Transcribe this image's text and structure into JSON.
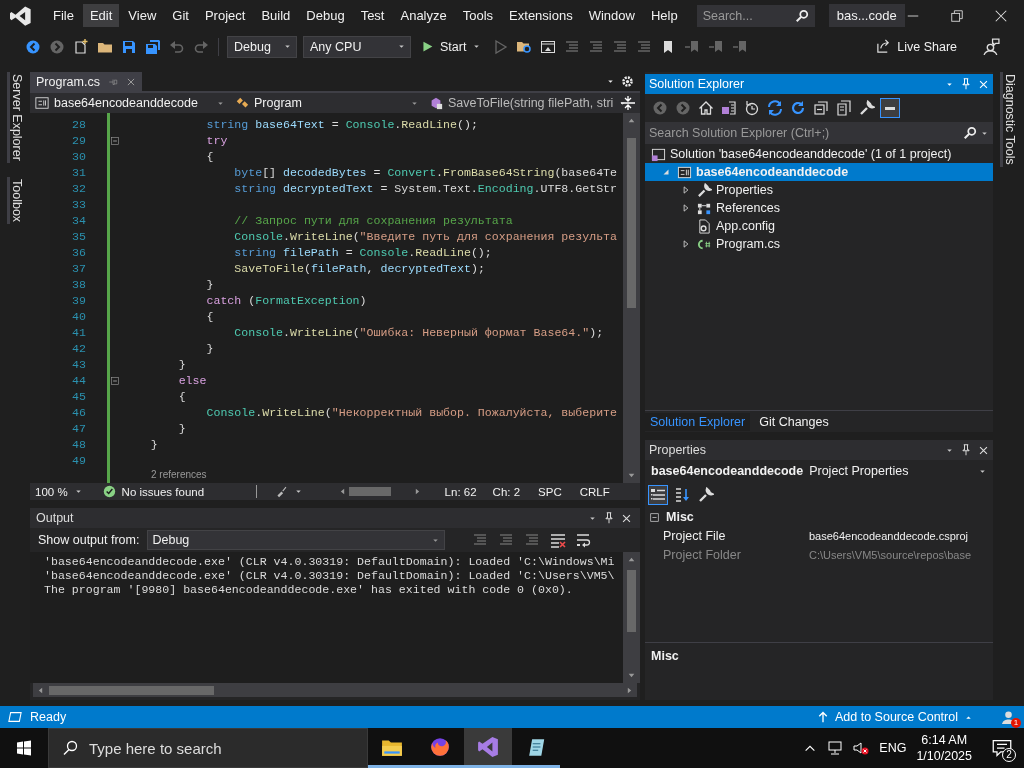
{
  "menu_bar": {
    "items": [
      {
        "label": "File",
        "selected": false
      },
      {
        "label": "Edit",
        "selected": true
      },
      {
        "label": "View",
        "selected": false
      },
      {
        "label": "Git",
        "selected": false
      },
      {
        "label": "Project",
        "selected": false
      },
      {
        "label": "Build",
        "selected": false
      },
      {
        "label": "Debug",
        "selected": false
      },
      {
        "label": "Test",
        "selected": false
      },
      {
        "label": "Analyze",
        "selected": false
      },
      {
        "label": "Tools",
        "selected": false
      },
      {
        "label": "Extensions",
        "selected": false
      },
      {
        "label": "Window",
        "selected": false
      },
      {
        "label": "Help",
        "selected": false
      }
    ],
    "search": {
      "placeholder": "Search..."
    },
    "title": "bas...code"
  },
  "toolbar": {
    "tools": [
      {
        "kind": "back",
        "disabled": false
      },
      {
        "kind": "forward",
        "disabled": true
      },
      {
        "kind": "new",
        "disabled": false
      },
      {
        "kind": "open",
        "disabled": false
      },
      {
        "kind": "save",
        "disabled": false
      },
      {
        "kind": "save-all",
        "disabled": false
      },
      {
        "kind": "undo",
        "disabled": true
      },
      {
        "kind": "redo",
        "disabled": true
      }
    ],
    "configuration": "Debug",
    "platform": "Any CPU",
    "start": "Start",
    "tools_2": [
      {
        "kind": "play",
        "disabled": true
      },
      {
        "kind": "find",
        "disabled": false
      },
      {
        "kind": "window",
        "disabled": false
      },
      {
        "kind": "lines",
        "disabled": true
      },
      {
        "kind": "lines",
        "disabled": true
      },
      {
        "kind": "lines",
        "disabled": true
      },
      {
        "kind": "lines",
        "disabled": true
      },
      {
        "kind": "bookmark",
        "disabled": false
      },
      {
        "kind": "bookmark-nav",
        "disabled": true
      },
      {
        "kind": "bookmark-nav",
        "disabled": true
      },
      {
        "kind": "bookmark-nav",
        "disabled": true
      }
    ],
    "live_share": "Live Share"
  },
  "left_side_tabs": [
    "Server Explorer",
    "Toolbox"
  ],
  "right_side_tabs": [
    "Diagnostic Tools"
  ],
  "editor": {
    "tabs": [
      {
        "label": "Program.cs",
        "selected": true
      }
    ],
    "nav": {
      "project": "base64encodeanddecode",
      "type": "Program",
      "member": "SaveToFile(string filePath, stri"
    },
    "lines": [
      {
        "number": "28",
        "fold": false,
        "tokens": [
          {
            "text": "            string",
            "kind": "kw"
          },
          {
            "text": " base64Text",
            "kind": "var"
          },
          {
            "text": " = ",
            "kind": "plain"
          },
          {
            "text": "Console",
            "kind": "type"
          },
          {
            "text": ".",
            "kind": "plain"
          },
          {
            "text": "ReadLine",
            "kind": "method"
          },
          {
            "text": "();",
            "kind": "plain"
          }
        ]
      },
      {
        "number": "29",
        "fold": true,
        "tokens": [
          {
            "text": "            try",
            "kind": "ctl"
          }
        ]
      },
      {
        "number": "30",
        "fold": false,
        "tokens": [
          {
            "text": "            {",
            "kind": "plain"
          }
        ]
      },
      {
        "number": "31",
        "fold": false,
        "tokens": [
          {
            "text": "                byte",
            "kind": "kw"
          },
          {
            "text": "[]",
            "kind": "plain"
          },
          {
            "text": " decodedBytes",
            "kind": "var"
          },
          {
            "text": " = ",
            "kind": "plain"
          },
          {
            "text": "Convert",
            "kind": "type"
          },
          {
            "text": ".",
            "kind": "plain"
          },
          {
            "text": "FromBase64String",
            "kind": "method"
          },
          {
            "text": "(base64Te",
            "kind": "plain"
          }
        ]
      },
      {
        "number": "32",
        "fold": false,
        "tokens": [
          {
            "text": "                string",
            "kind": "kw"
          },
          {
            "text": " decryptedText",
            "kind": "var"
          },
          {
            "text": " = System.Text.",
            "kind": "plain"
          },
          {
            "text": "Encoding",
            "kind": "type"
          },
          {
            "text": ".UTF8.GetStr",
            "kind": "plain"
          }
        ]
      },
      {
        "number": "33",
        "fold": false
      },
      {
        "number": "34",
        "fold": false,
        "tokens": [
          {
            "text": "                // Запрос пути для сохранения результата",
            "kind": "comment"
          }
        ]
      },
      {
        "number": "35",
        "fold": false,
        "tokens": [
          {
            "text": "                Console",
            "kind": "type"
          },
          {
            "text": ".",
            "kind": "plain"
          },
          {
            "text": "WriteLine",
            "kind": "method"
          },
          {
            "text": "(",
            "kind": "plain"
          },
          {
            "text": "\"Введите путь для сохранения результа",
            "kind": "str"
          }
        ]
      },
      {
        "number": "36",
        "fold": false,
        "tokens": [
          {
            "text": "                string",
            "kind": "kw"
          },
          {
            "text": " filePath",
            "kind": "var"
          },
          {
            "text": " = ",
            "kind": "plain"
          },
          {
            "text": "Console",
            "kind": "type"
          },
          {
            "text": ".",
            "kind": "plain"
          },
          {
            "text": "ReadLine",
            "kind": "method"
          },
          {
            "text": "();",
            "kind": "plain"
          }
        ]
      },
      {
        "number": "37",
        "fold": false,
        "tokens": [
          {
            "text": "                SaveToFile",
            "kind": "method"
          },
          {
            "text": "(",
            "kind": "plain"
          },
          {
            "text": "filePath",
            "kind": "var"
          },
          {
            "text": ",",
            "kind": "plain"
          },
          {
            "text": " decryptedText",
            "kind": "var"
          },
          {
            "text": ");",
            "kind": "plain"
          }
        ]
      },
      {
        "number": "38",
        "fold": false,
        "tokens": [
          {
            "text": "            }",
            "kind": "plain"
          }
        ]
      },
      {
        "number": "39",
        "fold": false,
        "tokens": [
          {
            "text": "            catch",
            "kind": "ctl"
          },
          {
            "text": " (",
            "kind": "plain"
          },
          {
            "text": "FormatException",
            "kind": "type"
          },
          {
            "text": ")",
            "kind": "plain"
          }
        ]
      },
      {
        "number": "40",
        "fold": false,
        "tokens": [
          {
            "text": "            {",
            "kind": "plain"
          }
        ]
      },
      {
        "number": "41",
        "fold": false,
        "tokens": [
          {
            "text": "                Console",
            "kind": "type"
          },
          {
            "text": ".",
            "kind": "plain"
          },
          {
            "text": "WriteLine",
            "kind": "method"
          },
          {
            "text": "(",
            "kind": "plain"
          },
          {
            "text": "\"Ошибка: Неверный формат Base64.\"",
            "kind": "str"
          },
          {
            "text": ");",
            "kind": "plain"
          }
        ]
      },
      {
        "number": "42",
        "fold": false,
        "tokens": [
          {
            "text": "            }",
            "kind": "plain"
          }
        ]
      },
      {
        "number": "43",
        "fold": false,
        "tokens": [
          {
            "text": "        }",
            "kind": "plain"
          }
        ]
      },
      {
        "number": "44",
        "fold": true,
        "tokens": [
          {
            "text": "        else",
            "kind": "ctl"
          }
        ]
      },
      {
        "number": "45",
        "fold": false,
        "tokens": [
          {
            "text": "        {",
            "kind": "plain"
          }
        ]
      },
      {
        "number": "46",
        "fold": false,
        "tokens": [
          {
            "text": "            Console",
            "kind": "type"
          },
          {
            "text": ".",
            "kind": "plain"
          },
          {
            "text": "WriteLine",
            "kind": "method"
          },
          {
            "text": "(",
            "kind": "plain"
          },
          {
            "text": "\"Некорректный выбор. Пожалуйста, выберите",
            "kind": "str"
          }
        ]
      },
      {
        "number": "47",
        "fold": false,
        "tokens": [
          {
            "text": "        }",
            "kind": "plain"
          }
        ]
      },
      {
        "number": "48",
        "fold": false,
        "tokens": [
          {
            "text": "    }",
            "kind": "plain"
          }
        ]
      },
      {
        "number": "49",
        "fold": false
      }
    ],
    "codelens": "2 references",
    "status": {
      "zoom": "100 %",
      "issues": "No issues found",
      "line": "Ln: 62",
      "column": "Ch: 2",
      "whitespace": "SPC",
      "line_ending": "CRLF"
    }
  },
  "output": {
    "title": "Output",
    "source_label": "Show output from:",
    "source": "Debug",
    "tools": [
      {
        "kind": "lines",
        "disabled": true
      },
      {
        "kind": "lines",
        "disabled": true
      },
      {
        "kind": "lines",
        "disabled": true
      },
      {
        "kind": "clear",
        "disabled": false
      },
      {
        "kind": "wrap",
        "disabled": false
      }
    ],
    "lines": [
      "'base64encodeanddecode.exe' (CLR v4.0.30319: DefaultDomain): Loaded 'C:\\Windows\\Mi",
      "'base64encodeanddecode.exe' (CLR v4.0.30319: DefaultDomain): Loaded 'C:\\Users\\VM5\\",
      "The program '[9980] base64encodeanddecode.exe' has exited with code 0 (0x0)."
    ]
  },
  "solution_explorer": {
    "title": "Solution Explorer",
    "tools": [
      {
        "kind": "back",
        "disabled": true,
        "on": false
      },
      {
        "kind": "forward",
        "disabled": true,
        "on": false
      },
      {
        "kind": "home",
        "disabled": false,
        "on": false
      },
      {
        "kind": "switch-view",
        "disabled": false,
        "on": false
      },
      {
        "kind": "history",
        "disabled": false,
        "on": false
      },
      {
        "kind": "sync",
        "disabled": false,
        "on": false
      },
      {
        "kind": "refresh",
        "disabled": false,
        "on": false
      },
      {
        "kind": "collapse",
        "disabled": false,
        "on": false
      },
      {
        "kind": "copy",
        "disabled": false,
        "on": false
      },
      {
        "kind": "wrench",
        "disabled": false,
        "on": false
      },
      {
        "kind": "preview",
        "disabled": false,
        "on": true
      }
    ],
    "search": {
      "placeholder": "Search Solution Explorer (Ctrl+;)"
    },
    "tree": [
      {
        "label": "Solution 'base64encodeanddecode' (1 of 1 project)",
        "kind": "solution",
        "expandable": false,
        "expanded": true,
        "selected": false,
        "startup": false,
        "children": [
          {
            "label": "base64encodeanddecode",
            "kind": "csproject",
            "expandable": true,
            "expanded": true,
            "selected": true,
            "startup": true,
            "children": [
              {
                "label": "Properties",
                "kind": "wrench",
                "expandable": true,
                "expanded": false,
                "selected": false,
                "startup": false
              },
              {
                "label": "References",
                "kind": "references",
                "expandable": true,
                "expanded": false,
                "selected": false,
                "startup": false
              },
              {
                "label": "App.config",
                "kind": "config",
                "expandable": false,
                "selected": false,
                "startup": false
              },
              {
                "label": "Program.cs",
                "kind": "csharp",
                "expandable": true,
                "expanded": false,
                "selected": false,
                "startup": false
              }
            ]
          }
        ]
      }
    ],
    "tabs": [
      {
        "label": "Solution Explorer",
        "selected": true
      },
      {
        "label": "Git Changes",
        "selected": false
      }
    ]
  },
  "properties": {
    "title": "Properties",
    "object": "base64encodeanddecode",
    "object_type": "Project Properties",
    "tools": [
      {
        "kind": "categorized",
        "on": true
      },
      {
        "kind": "alphabetical",
        "on": false
      },
      {
        "kind": "wrench",
        "on": false
      }
    ],
    "categories": [
      {
        "label": "Misc",
        "expanded": true,
        "rows": [
          {
            "name": "Project File",
            "value": "base64encodeanddecode.csproj",
            "disabled": false
          },
          {
            "name": "Project Folder",
            "value": "C:\\Users\\VM5\\source\\repos\\base",
            "disabled": true
          }
        ]
      }
    ],
    "description": "Misc"
  },
  "status_bar": {
    "text": "Ready",
    "source_control": "Add to Source Control",
    "notifications": "1"
  },
  "taskbar": {
    "search": {
      "placeholder": "Type here to search"
    },
    "apps": [
      {
        "kind": "files",
        "selected": false
      },
      {
        "kind": "browser",
        "selected": false
      },
      {
        "kind": "vs",
        "selected": true
      },
      {
        "kind": "notepad",
        "selected": false
      }
    ],
    "language": "ENG",
    "time": "6:14 AM",
    "date": "1/10/2025",
    "notifications": "2"
  }
}
